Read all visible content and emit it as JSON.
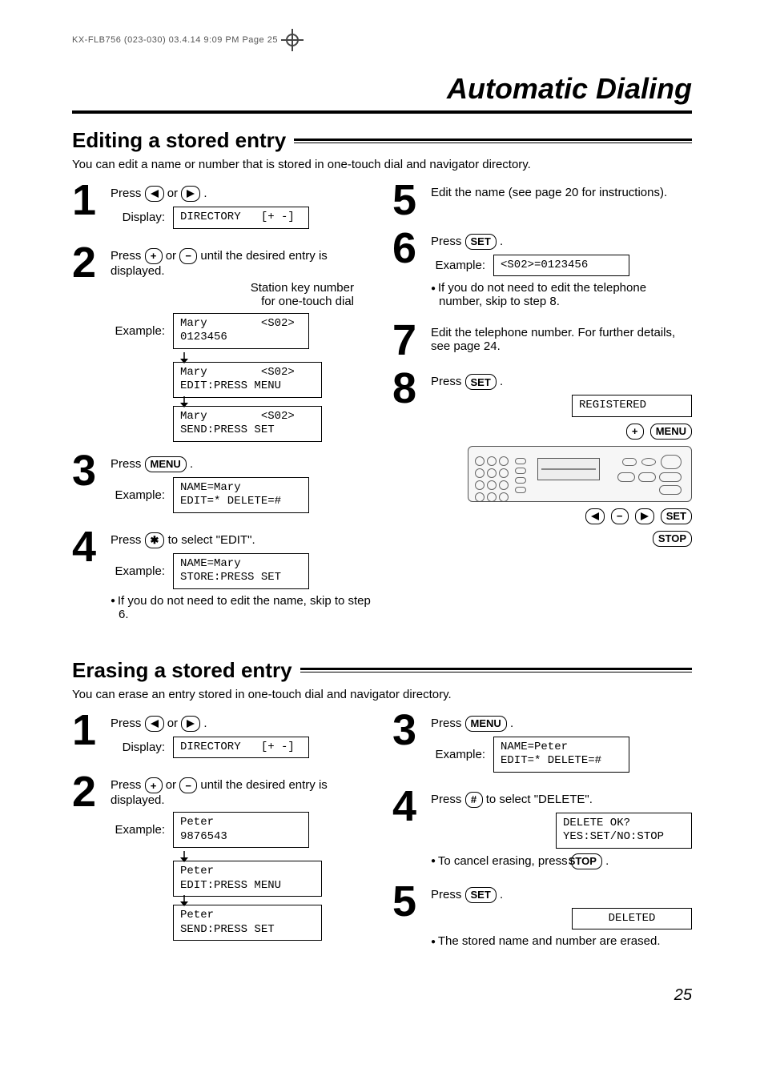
{
  "header_tag": "KX-FLB756 (023-030)  03.4.14  9:09 PM  Page 25",
  "section_title": "Automatic Dialing",
  "edit": {
    "title": "Editing a stored entry",
    "intro": "You can edit a name or number that is stored in one-touch dial and navigator directory.",
    "steps": {
      "s1_text_a": "Press ",
      "s1_text_b": " or ",
      "s1_text_c": ".",
      "s1_display_label": "Display:",
      "s1_lcd": "DIRECTORY   [+ -]",
      "s2_text_a": "Press ",
      "s2_text_b": " or ",
      "s2_text_c": " until the desired entry is displayed.",
      "s2_station_note": "Station key number\nfor one-touch dial",
      "s2_example_label": "Example:",
      "s2_lcd1": "Mary        <S02>\n0123456",
      "s2_lcd2": "Mary        <S02>\nEDIT:PRESS MENU",
      "s2_lcd3": "Mary        <S02>\nSEND:PRESS SET",
      "s3_text_a": "Press ",
      "s3_text_b": ".",
      "s3_example_label": "Example:",
      "s3_lcd": "NAME=Mary\nEDIT=* DELETE=#",
      "s4_text_a": "Press ",
      "s4_text_b": " to select \"EDIT\".",
      "s4_example_label": "Example:",
      "s4_lcd": "NAME=Mary\nSTORE:PRESS SET",
      "s4_bullet": "If you do not need to edit the name, skip to step 6.",
      "s5_text": "Edit the name (see page 20 for instructions).",
      "s6_text_a": "Press ",
      "s6_text_b": ".",
      "s6_example_label": "Example:",
      "s6_lcd": "<S02>=0123456",
      "s6_bullet": "If you do not need to edit the telephone number, skip to step 8.",
      "s7_text": "Edit the telephone number. For further details, see page 24.",
      "s8_text_a": "Press ",
      "s8_text_b": ".",
      "s8_lcd": "REGISTERED"
    },
    "legend_keys": {
      "plus": "+",
      "menu": "MENU",
      "left": "◀",
      "minus": "−",
      "right": "▶",
      "set": "SET",
      "stop": "STOP"
    }
  },
  "erase": {
    "title": "Erasing a stored entry",
    "intro": "You can erase an entry stored in one-touch dial and navigator directory.",
    "steps": {
      "s1_text_a": "Press ",
      "s1_text_b": " or ",
      "s1_text_c": ".",
      "s1_display_label": "Display:",
      "s1_lcd": "DIRECTORY   [+ -]",
      "s2_text_a": "Press ",
      "s2_text_b": " or ",
      "s2_text_c": " until the desired entry is displayed.",
      "s2_example_label": "Example:",
      "s2_lcd1": "Peter\n9876543",
      "s2_lcd2": "Peter\nEDIT:PRESS MENU",
      "s2_lcd3": "Peter\nSEND:PRESS SET",
      "s3_text_a": "Press ",
      "s3_text_b": ".",
      "s3_example_label": "Example:",
      "s3_lcd": "NAME=Peter\nEDIT=* DELETE=#",
      "s4_text_a": "Press ",
      "s4_text_b": " to select \"DELETE\".",
      "s4_lcd": "DELETE OK?\nYES:SET/NO:STOP",
      "s4_bullet_a": "To cancel erasing, press ",
      "s4_bullet_b": ".",
      "s5_text_a": "Press ",
      "s5_text_b": ".",
      "s5_lcd": "DELETED",
      "s5_bullet": "The stored name and number are erased."
    }
  },
  "key_labels": {
    "menu": "MENU",
    "set": "SET",
    "stop": "STOP",
    "plus": "+",
    "minus": "−",
    "left": "◀",
    "right": "▶",
    "star": "✱",
    "hash": "#"
  },
  "page_number": "25"
}
